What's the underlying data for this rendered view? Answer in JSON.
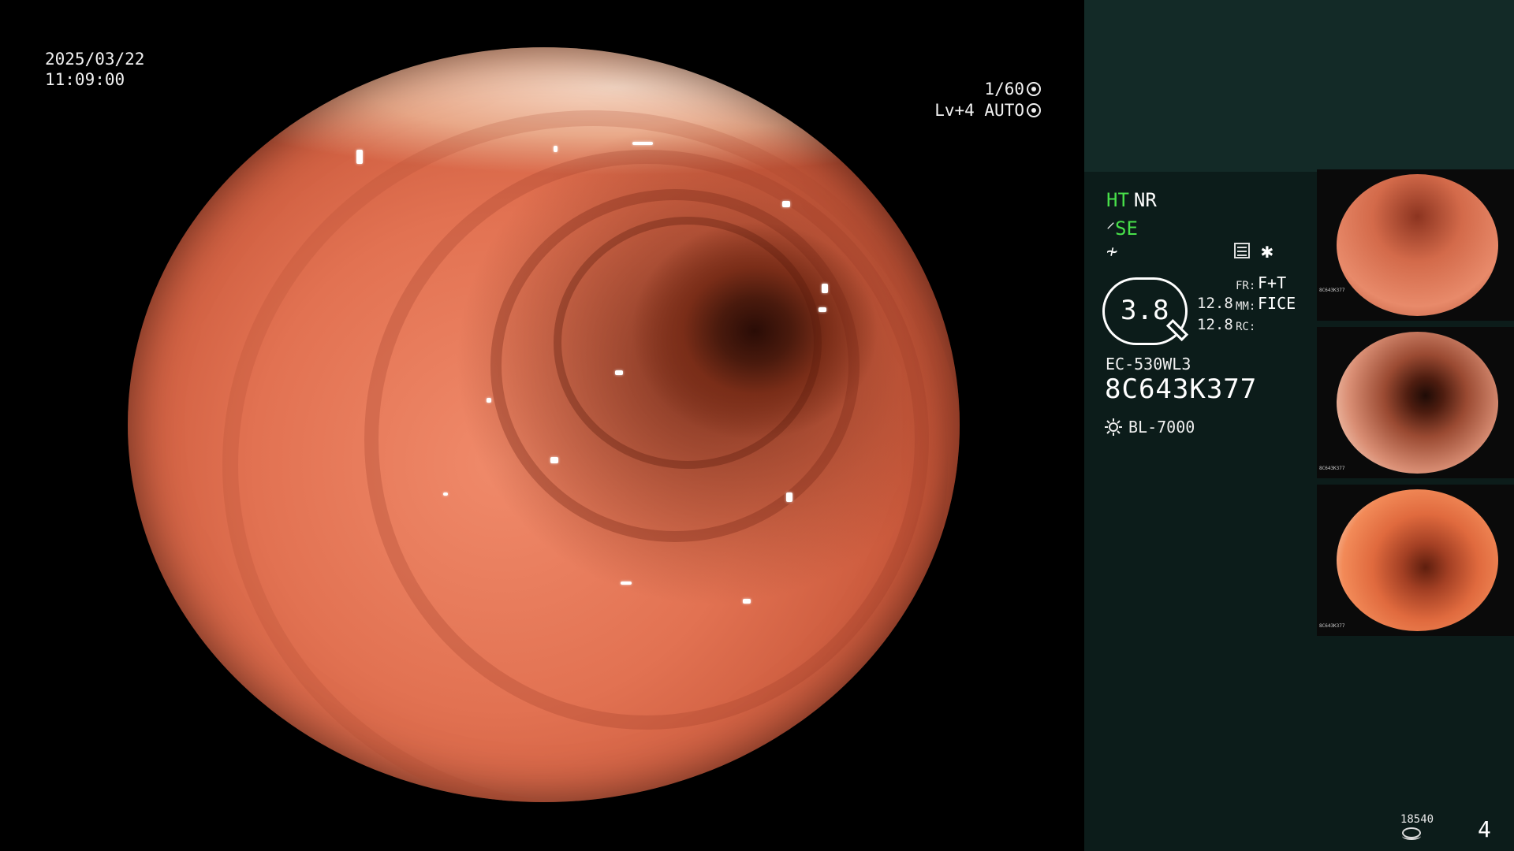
{
  "overlay": {
    "date": "2025/03/22",
    "time": "11:09:00",
    "shutter": "1/60",
    "iris": "Lv+4 AUTO"
  },
  "status": {
    "ht": "HT",
    "nr": "NR",
    "se": "SE",
    "zoom": "3.8",
    "value1": "12.8",
    "value2": "12.8",
    "fr_label": "FR:",
    "fr_value": "F+T",
    "mm_label": "MM:",
    "mm_value": "FICE",
    "rc_label": "RC:",
    "accent_green": "#48e04a"
  },
  "device": {
    "model": "EC-530WL3",
    "serial": "8C643K377",
    "light_source": "BL-7000"
  },
  "thumbnails": [
    {
      "label": "8C643K377"
    },
    {
      "label": "8C643K377"
    },
    {
      "label": "8C643K377"
    }
  ],
  "footer": {
    "counter": "18540",
    "page": "4"
  },
  "icons": {
    "shutter": "shutter-icon",
    "iris": "iris-icon",
    "structure": "structure-enhance-icon",
    "color": "color-enhance-icon",
    "menu": "menu-icon",
    "star": "star-icon",
    "light": "sun-icon",
    "storage": "disk-icon"
  }
}
